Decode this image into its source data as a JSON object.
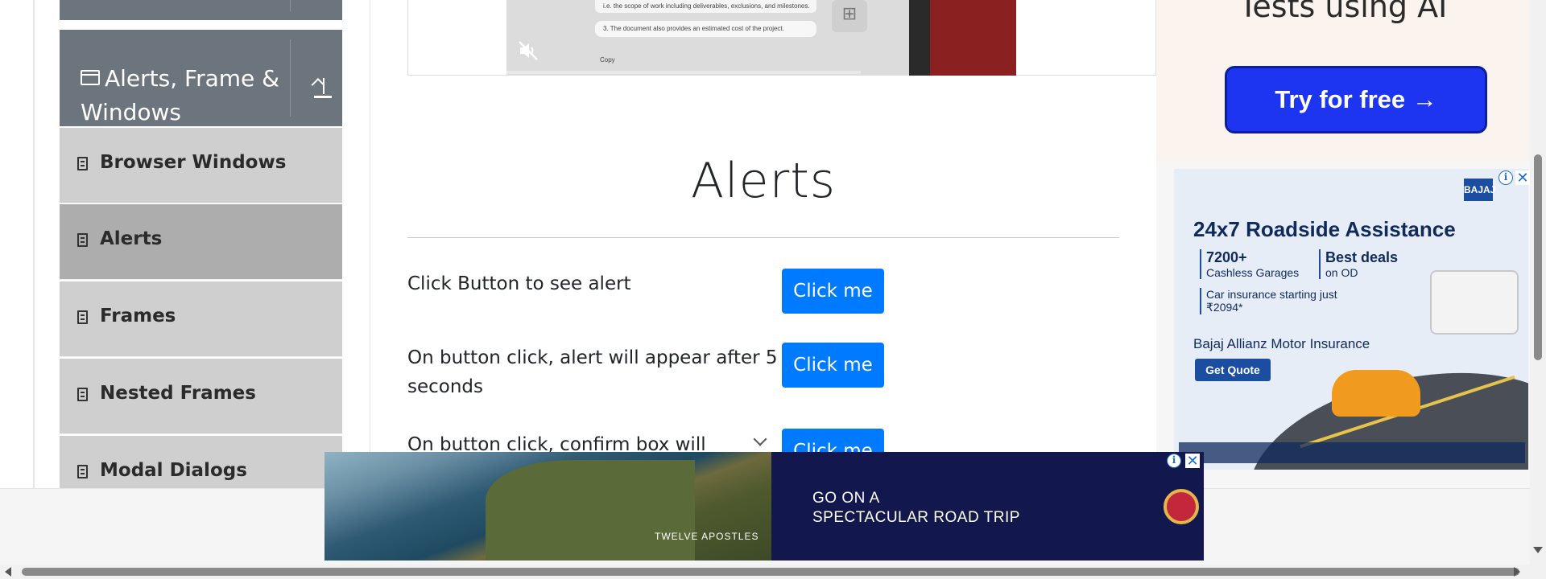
{
  "sidebar": {
    "group_title": "Alerts, Frame & Windows",
    "icons": {
      "group": "window-icon",
      "collapse": "arrow-up-icon",
      "item": "document-icon"
    },
    "items": [
      {
        "label": "Browser Windows"
      },
      {
        "label": "Alerts"
      },
      {
        "label": "Frames"
      },
      {
        "label": "Nested Frames"
      },
      {
        "label": "Modal Dialogs"
      }
    ]
  },
  "video": {
    "doc_line_1": "i.e. the scope of work including deliverables, exclusions, and milestones.",
    "doc_line_2": "3. The document also provides an estimated cost of the project.",
    "copy_label": "Copy",
    "icons": {
      "mute": "muted-speaker-icon",
      "grid": "grid-icon"
    }
  },
  "main": {
    "heading": "Alerts",
    "rows": [
      {
        "text": "Click Button to see alert",
        "button": "Click me"
      },
      {
        "text": "On button click, alert will appear after 5 seconds",
        "button": "Click me"
      },
      {
        "text": "On button click, confirm box will",
        "button": "Click me"
      }
    ]
  },
  "ads": {
    "ai": {
      "title": "Tests using AI",
      "cta": "Try for free →"
    },
    "bajaj": {
      "logo": "BAJAJ",
      "headline": "24x7 Roadside Assistance",
      "stat1_big": "7200+",
      "stat1_small": "Cashless Garages",
      "stat2_big": "Best deals",
      "stat2_small": "on OD",
      "car_insurance": "Car insurance starting just ₹2094*",
      "brand": "Bajaj Allianz Motor Insurance",
      "quote": "Get Quote"
    },
    "bottom": {
      "caption": "TWELVE APOSTLES",
      "headline_1": "GO ON A",
      "headline_2": "SPECTACULAR ROAD TRIP"
    },
    "info_symbol": "i",
    "close_symbol": "✕"
  },
  "colors": {
    "sidebar_group": "#6c757d",
    "menu_item": "#cfcfcf",
    "menu_item_active": "#adadad",
    "primary_button": "#007bff",
    "ai_cta": "#1d35f0",
    "bottom_ad_bg": "#12184e"
  }
}
